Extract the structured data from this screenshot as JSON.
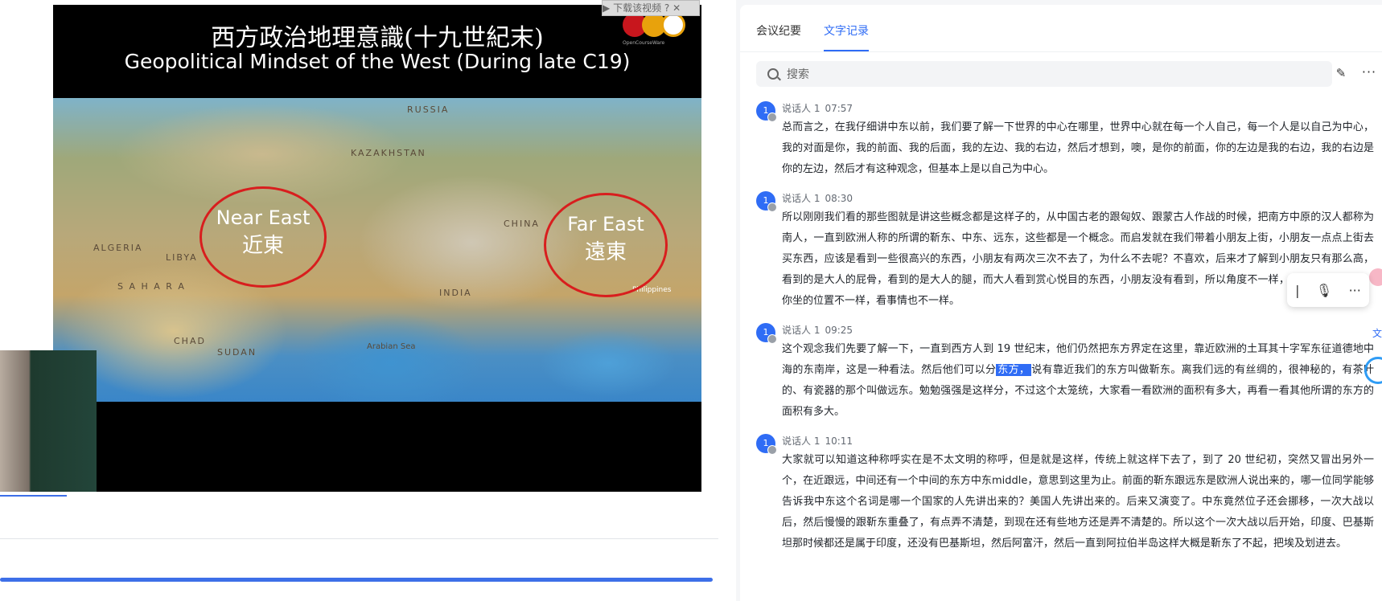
{
  "video": {
    "slide_title_cn": "西方政治地理意識(十九世紀末)",
    "slide_title_en": "Geopolitical Mindset of the West (During late C19)",
    "map_labels": {
      "russia": "RUSSIA",
      "china": "CHINA",
      "india": "INDIA",
      "algeria": "ALGERIA",
      "libya": "LIBYA",
      "sahara": "S A H A R A",
      "chad": "CHAD",
      "sudan": "SUDAN",
      "arabian_sea": "Arabian Sea",
      "kazakhstan": "KAZAKHSTAN",
      "philippines": "Philippines"
    },
    "near_east_en": "Near East",
    "near_east_cn": "近東",
    "far_east_en": "Far East",
    "far_east_cn": "遠東",
    "logo_sub": "OpenCourseWare",
    "download_label": "下载该视频"
  },
  "tabs": [
    {
      "label": "会议纪要"
    },
    {
      "label": "文字记录"
    }
  ],
  "search": {
    "placeholder": "搜索"
  },
  "entries": [
    {
      "avatar": "1",
      "speaker": "说话人 1",
      "time": "07:57",
      "text": "总而言之，在我仔细讲中东以前，我们要了解一下世界的中心在哪里，世界中心就在每一个人自己，每一个人是以自己为中心，我的对面是你，我的前面、我的后面，我的左边、我的右边，然后才想到，噢，是你的前面，你的左边是我的右边，我的右边是你的左边，然后才有这种观念，但基本上是以自己为中心。"
    },
    {
      "avatar": "1",
      "speaker": "说话人 1",
      "time": "08:30",
      "text": "所以刚刚我们看的那些图就是讲这些概念都是这样子的，从中国古老的跟匈奴、跟蒙古人作战的时候，把南方中原的汉人都称为南人，一直到欧洲人称的所谓的靳东、中东、远东，这些都是一个概念。而启发就在我们带着小朋友上街，小朋友一点点上街去买东西，应该是看到一些很高兴的东西，小朋友有两次三次不去了，为什么不去呢？不喜欢，后来才了解到小朋友只有那么高，看到的是大人的屁骨，看到的是大人的腿，而大人看到赏心悦目的东西，小朋友没有看到，所以角度不一样，看事情也不一样，你坐的位置不一样，看事情也不一样。"
    },
    {
      "avatar": "1",
      "speaker": "说话人 1",
      "time": "09:25",
      "text_before": "这个观念我们先要了解一下，一直到西方人到 19 世纪末，他们仍然把东方界定在这里，靠近欧洲的土耳其十字军东征道德地中海的东南岸，这是一种看法。然后他们可以分",
      "text_highlight": "东方，",
      "text_after": "说有靠近我们的东方叫做靳东。离我们远的有丝绸的，很神秘的，有茶叶的、有瓷器的那个叫做远东。勉勉强强是这样分，不过这个太笼统，大家看一看欧洲的面积有多大，再看一看其他所谓的东方的面积有多大。"
    },
    {
      "avatar": "1",
      "speaker": "说话人 1",
      "time": "10:11",
      "text": "大家就可以知道这种称呼实在是不太文明的称呼，但是就是这样，传统上就这样下去了，到了 20 世纪初，突然又冒出另外一个，在近跟远，中间还有一个中间的东方中东middle，意思到这里为止。前面的靳东跟远东是欧洲人说出来的，哪一位同学能够告诉我中东这个名词是哪一个国家的人先讲出来的？美国人先讲出来的。后来又演变了。中东竟然位子还会挪移，一次大战以后，然后慢慢的跟靳东重叠了，有点弄不清楚，到现在还有些地方还是弄不清楚的。所以这个一次大战以后开始，印度、巴基斯坦那时候都还是属于印度，还没有巴基斯坦，然后阿富汗，然后一直到阿拉伯半岛这样大概是靳东了不起，把埃及划进去。"
    }
  ],
  "colors": {
    "accent": "#2f6cf5",
    "circle": "#d81e1e"
  },
  "icons": {
    "search": "search-icon",
    "edit": "pencil-icon",
    "more": "more-icon",
    "mic": "microphone-icon"
  }
}
